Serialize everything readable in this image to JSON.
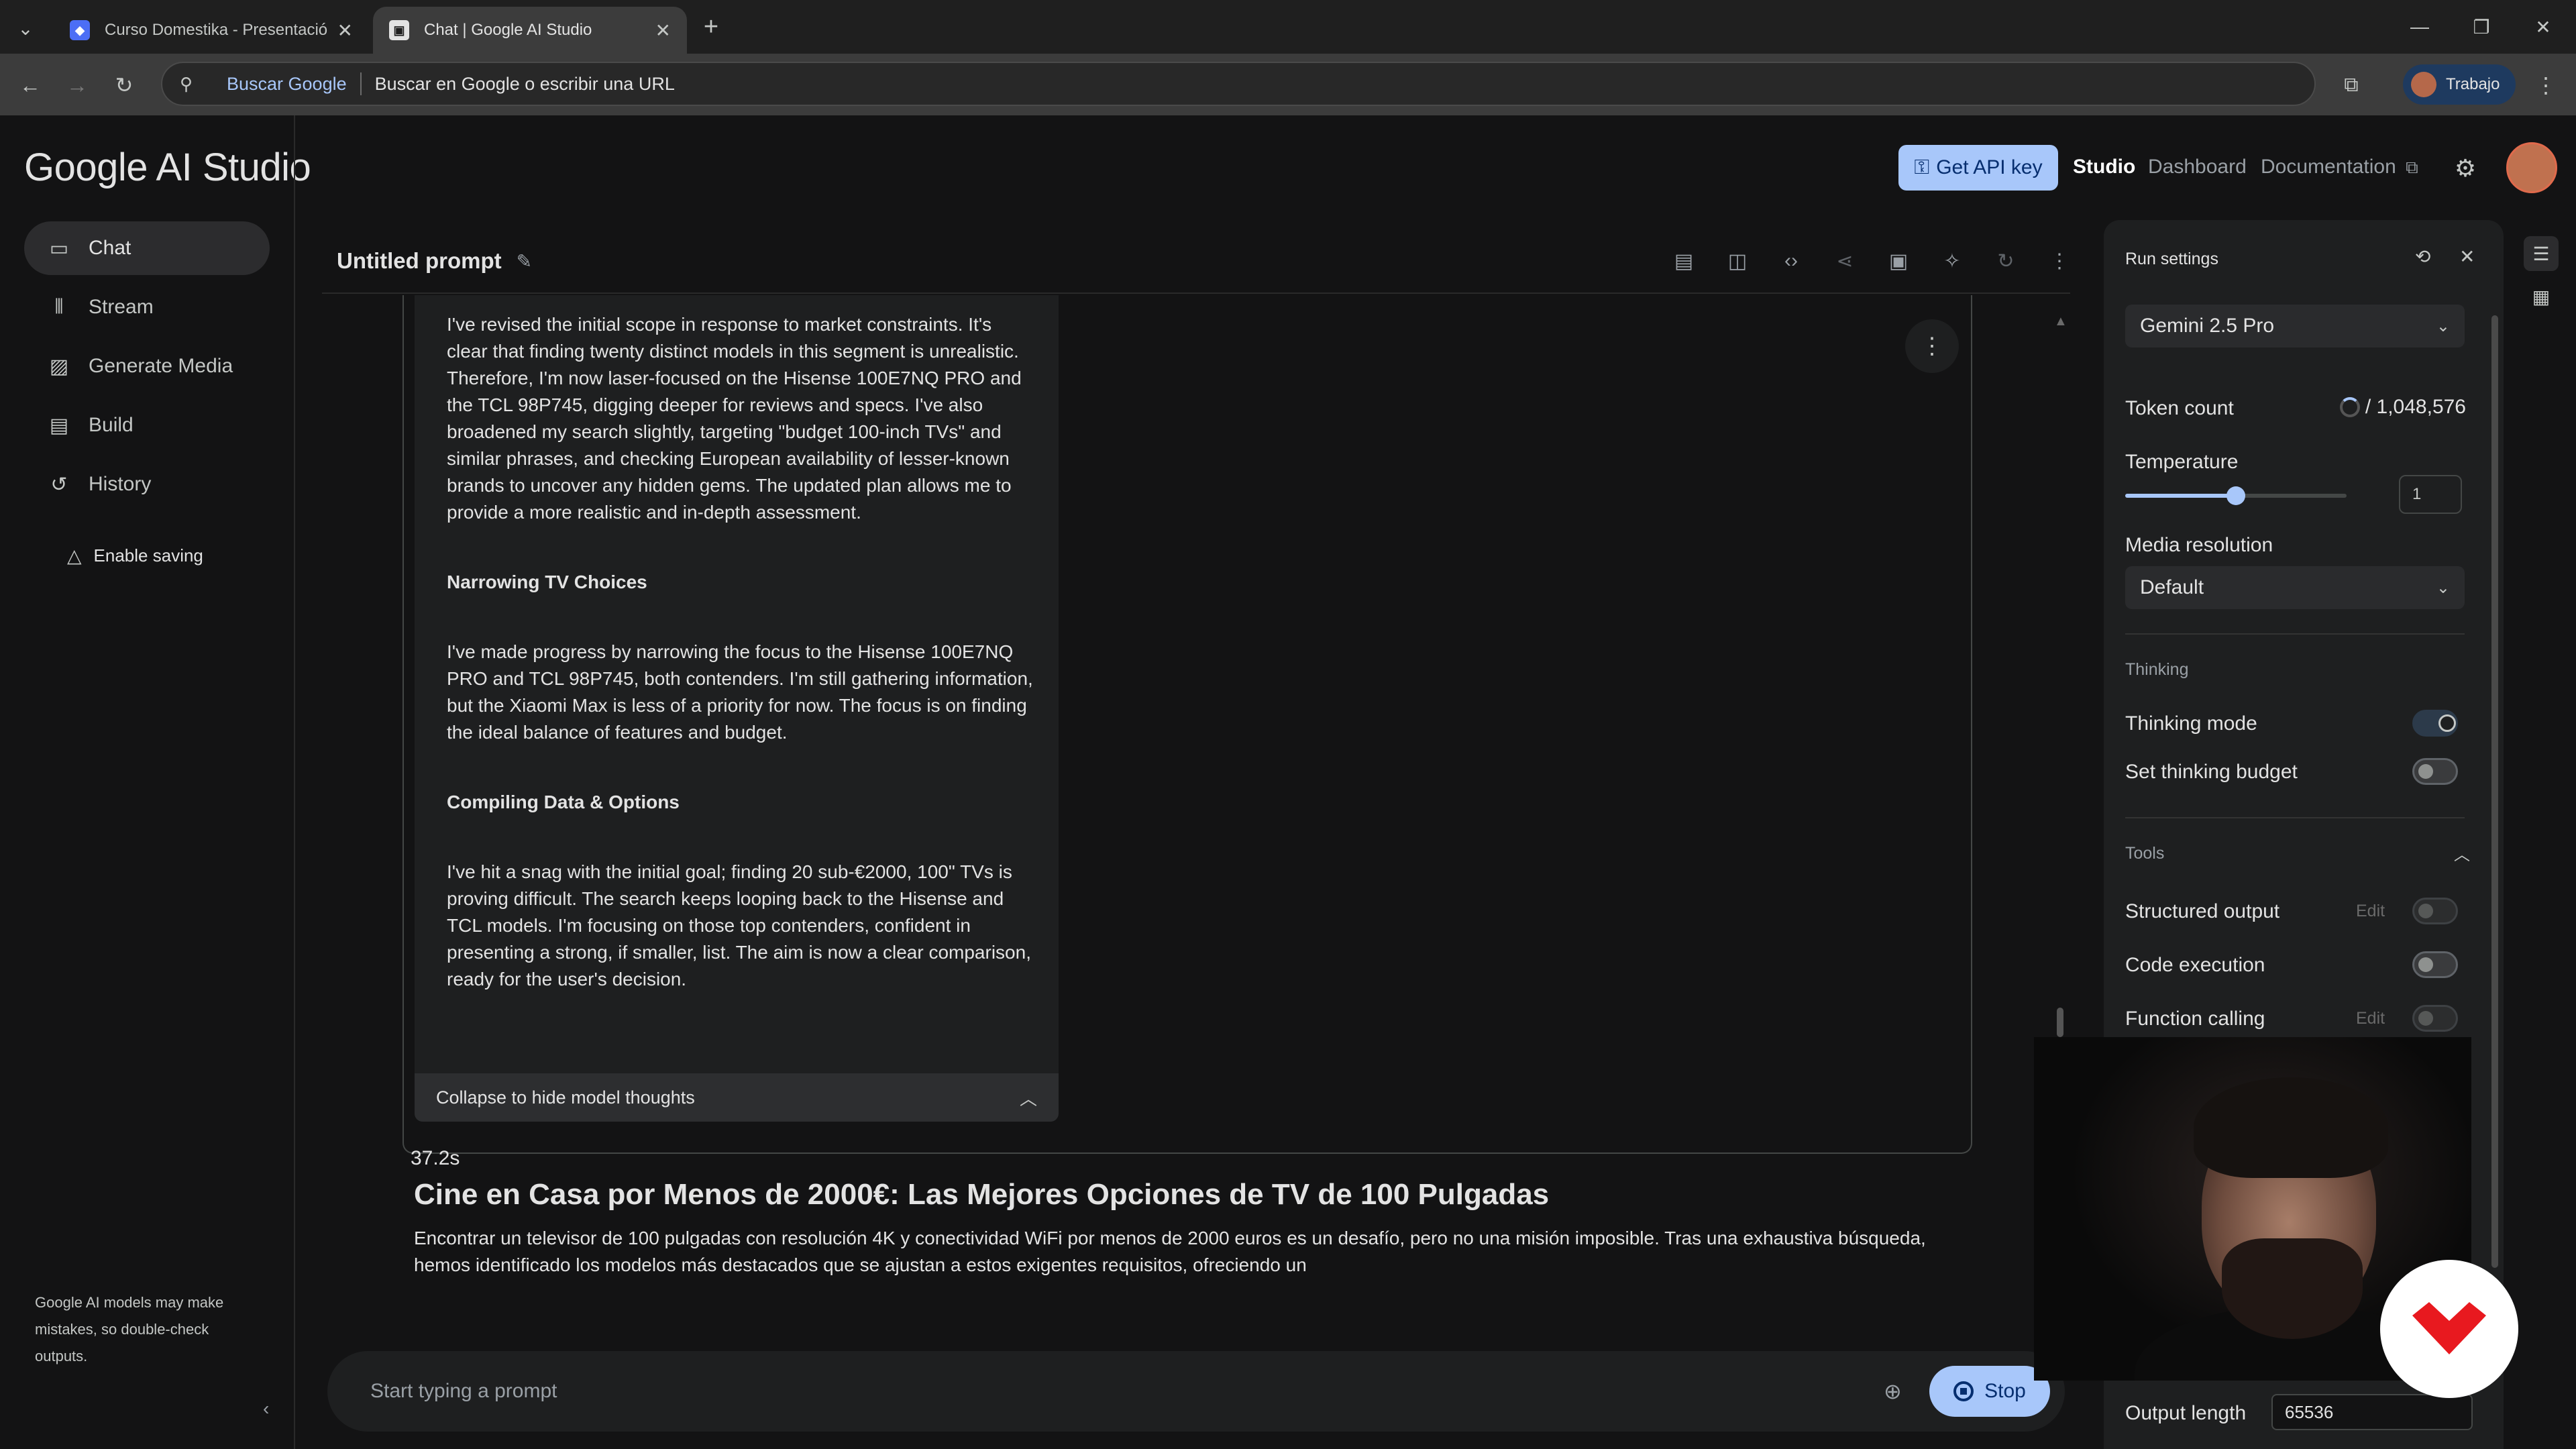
{
  "browser": {
    "tabs": [
      {
        "title": "Curso Domestika - Presentación"
      },
      {
        "title": "Chat | Google AI Studio"
      }
    ],
    "omnibox": {
      "engine": "Buscar Google",
      "hint": "Buscar en Google o escribir una URL"
    },
    "profile": "Trabajo"
  },
  "header": {
    "brand": "Google AI Studio",
    "get_api_key": "Get API key",
    "links": {
      "studio": "Studio",
      "dashboard": "Dashboard",
      "documentation": "Documentation"
    }
  },
  "sidebar": {
    "items": [
      {
        "label": "Chat",
        "icon": "chat-icon"
      },
      {
        "label": "Stream",
        "icon": "stream-icon"
      },
      {
        "label": "Generate Media",
        "icon": "media-icon"
      },
      {
        "label": "Build",
        "icon": "build-icon"
      },
      {
        "label": "History",
        "icon": "history-icon"
      }
    ],
    "enable_saving": "Enable saving",
    "disclaimer": "Google AI models may make mistakes, so double-check outputs."
  },
  "main": {
    "prompt_title": "Untitled prompt",
    "thoughts": {
      "p1": "I've revised the initial scope in response to market constraints. It's clear that finding twenty distinct models in this segment is unrealistic. Therefore, I'm now laser-focused on the Hisense 100E7NQ PRO and the TCL 98P745, digging deeper for reviews and specs. I've also broadened my search slightly, targeting \"budget 100-inch TVs\" and similar phrases, and checking European availability of lesser-known brands to uncover any hidden gems. The updated plan allows me to provide a more realistic and in-depth assessment.",
      "h2": "Narrowing TV Choices",
      "p2": "I've made progress by narrowing the focus to the Hisense 100E7NQ PRO and TCL 98P745, both contenders. I'm still gathering information, but the Xiaomi Max is less of a priority for now. The focus is on finding the ideal balance of features and budget.",
      "h3": "Compiling Data & Options",
      "p3": "I've hit a snag with the initial goal; finding 20 sub-€2000, 100\" TVs is proving difficult. The search keeps looping back to the Hisense and TCL models. I'm focusing on those top contenders, confident in presenting a strong, if smaller, list. The aim is now a clear comparison, ready for the user's decision.",
      "collapse_label": "Collapse to hide model thoughts"
    },
    "elapsed": "37.2s",
    "answer_title": "Cine en Casa por Menos de 2000€: Las Mejores Opciones de TV de 100 Pulgadas",
    "answer_text": "Encontrar un televisor de 100 pulgadas con resolución 4K y conectividad WiFi por menos de 2000 euros es un desafío, pero no una misión imposible. Tras una exhaustiva búsqueda, hemos identificado los modelos más destacados que se ajustan a estos exigentes requisitos, ofreciendo un",
    "prompt_placeholder": "Start typing a prompt",
    "stop_label": "Stop"
  },
  "run_settings": {
    "title": "Run settings",
    "model": "Gemini 2.5 Pro",
    "token_count_label": "Token count",
    "token_count_value": "/ 1,048,576",
    "temperature_label": "Temperature",
    "temperature_value": "1",
    "temperature_fraction": 0.5,
    "media_resolution_label": "Media resolution",
    "media_resolution_value": "Default",
    "thinking_section": "Thinking",
    "thinking_mode_label": "Thinking mode",
    "thinking_mode_on": true,
    "thinking_budget_label": "Set thinking budget",
    "thinking_budget_on": false,
    "tools_section": "Tools",
    "structured_output_label": "Structured output",
    "code_execution_label": "Code execution",
    "function_calling_label": "Function calling",
    "edit_label": "Edit",
    "output_length_label": "Output length",
    "output_length_value": "65536"
  },
  "colors": {
    "accent": "#a8c7fa",
    "background": "#131314",
    "panel": "#1e1f20",
    "brand_logo": "#e8191f"
  }
}
